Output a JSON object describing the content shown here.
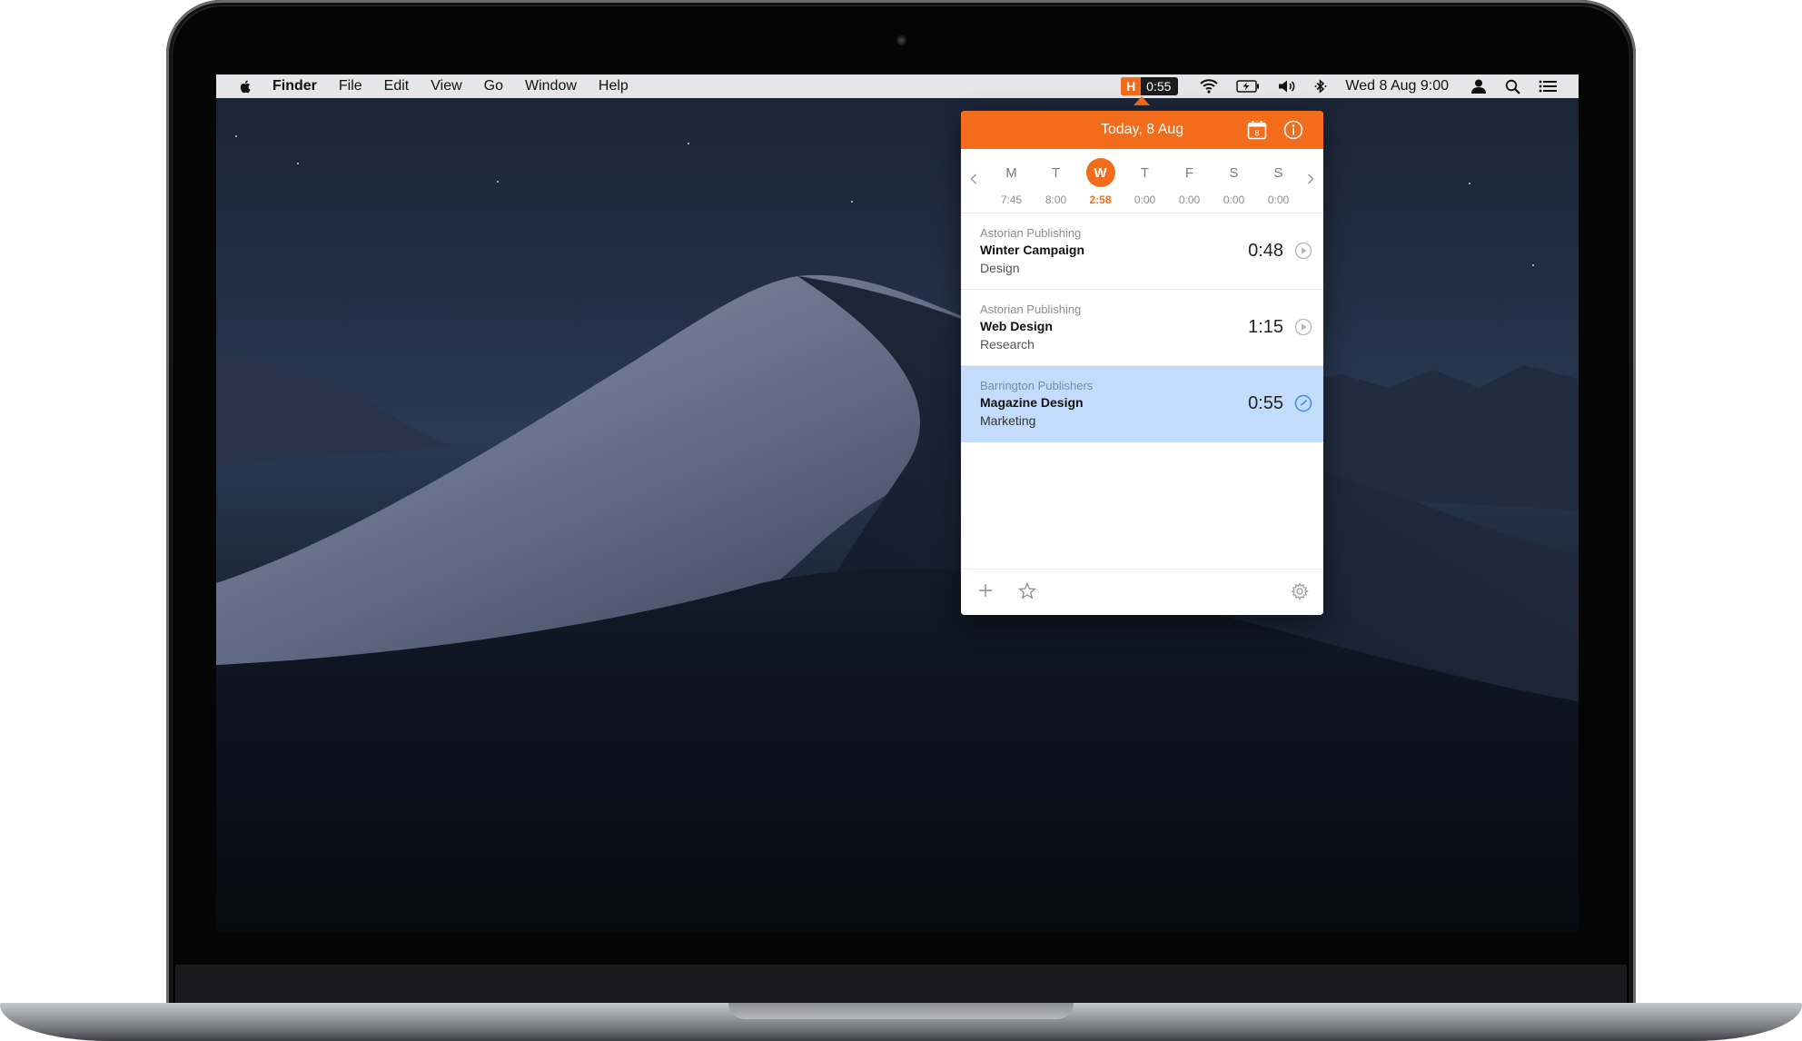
{
  "menubar": {
    "apple_icon": "apple-icon",
    "app_name": "Finder",
    "menus": [
      "File",
      "Edit",
      "View",
      "Go",
      "Window",
      "Help"
    ],
    "tracker": {
      "logo": "H",
      "time": "0:55"
    },
    "clock": "Wed 8 Aug  9:00",
    "status_icons": [
      "wifi-icon",
      "battery-icon",
      "volume-icon",
      "bluetooth-icon",
      "user-icon",
      "spotlight-search-icon",
      "notification-center-icon"
    ]
  },
  "popover": {
    "header": {
      "title": "Today, 8 Aug",
      "calendar_day": "8",
      "icons": [
        "calendar-icon",
        "info-icon"
      ]
    },
    "week": {
      "days": [
        {
          "letter": "M",
          "hours": "7:45",
          "active": false
        },
        {
          "letter": "T",
          "hours": "8:00",
          "active": false
        },
        {
          "letter": "W",
          "hours": "2:58",
          "active": true
        },
        {
          "letter": "T",
          "hours": "0:00",
          "active": false
        },
        {
          "letter": "F",
          "hours": "0:00",
          "active": false
        },
        {
          "letter": "S",
          "hours": "0:00",
          "active": false
        },
        {
          "letter": "S",
          "hours": "0:00",
          "active": false
        }
      ]
    },
    "entries": [
      {
        "client": "Astorian Publishing",
        "project": "Winter Campaign",
        "task": "Design",
        "time": "0:48",
        "state": "stopped"
      },
      {
        "client": "Astorian Publishing",
        "project": "Web Design",
        "task": "Research",
        "time": "1:15",
        "state": "stopped"
      },
      {
        "client": "Barrington Publishers",
        "project": "Magazine Design",
        "task": "Marketing",
        "time": "0:55",
        "state": "running"
      }
    ],
    "footer_icons": [
      "add-icon",
      "favorites-star-icon",
      "settings-gear-icon"
    ]
  },
  "colors": {
    "accent": "#f36c1c",
    "selection": "#c3dcfb",
    "running": "#3d8ef0"
  }
}
